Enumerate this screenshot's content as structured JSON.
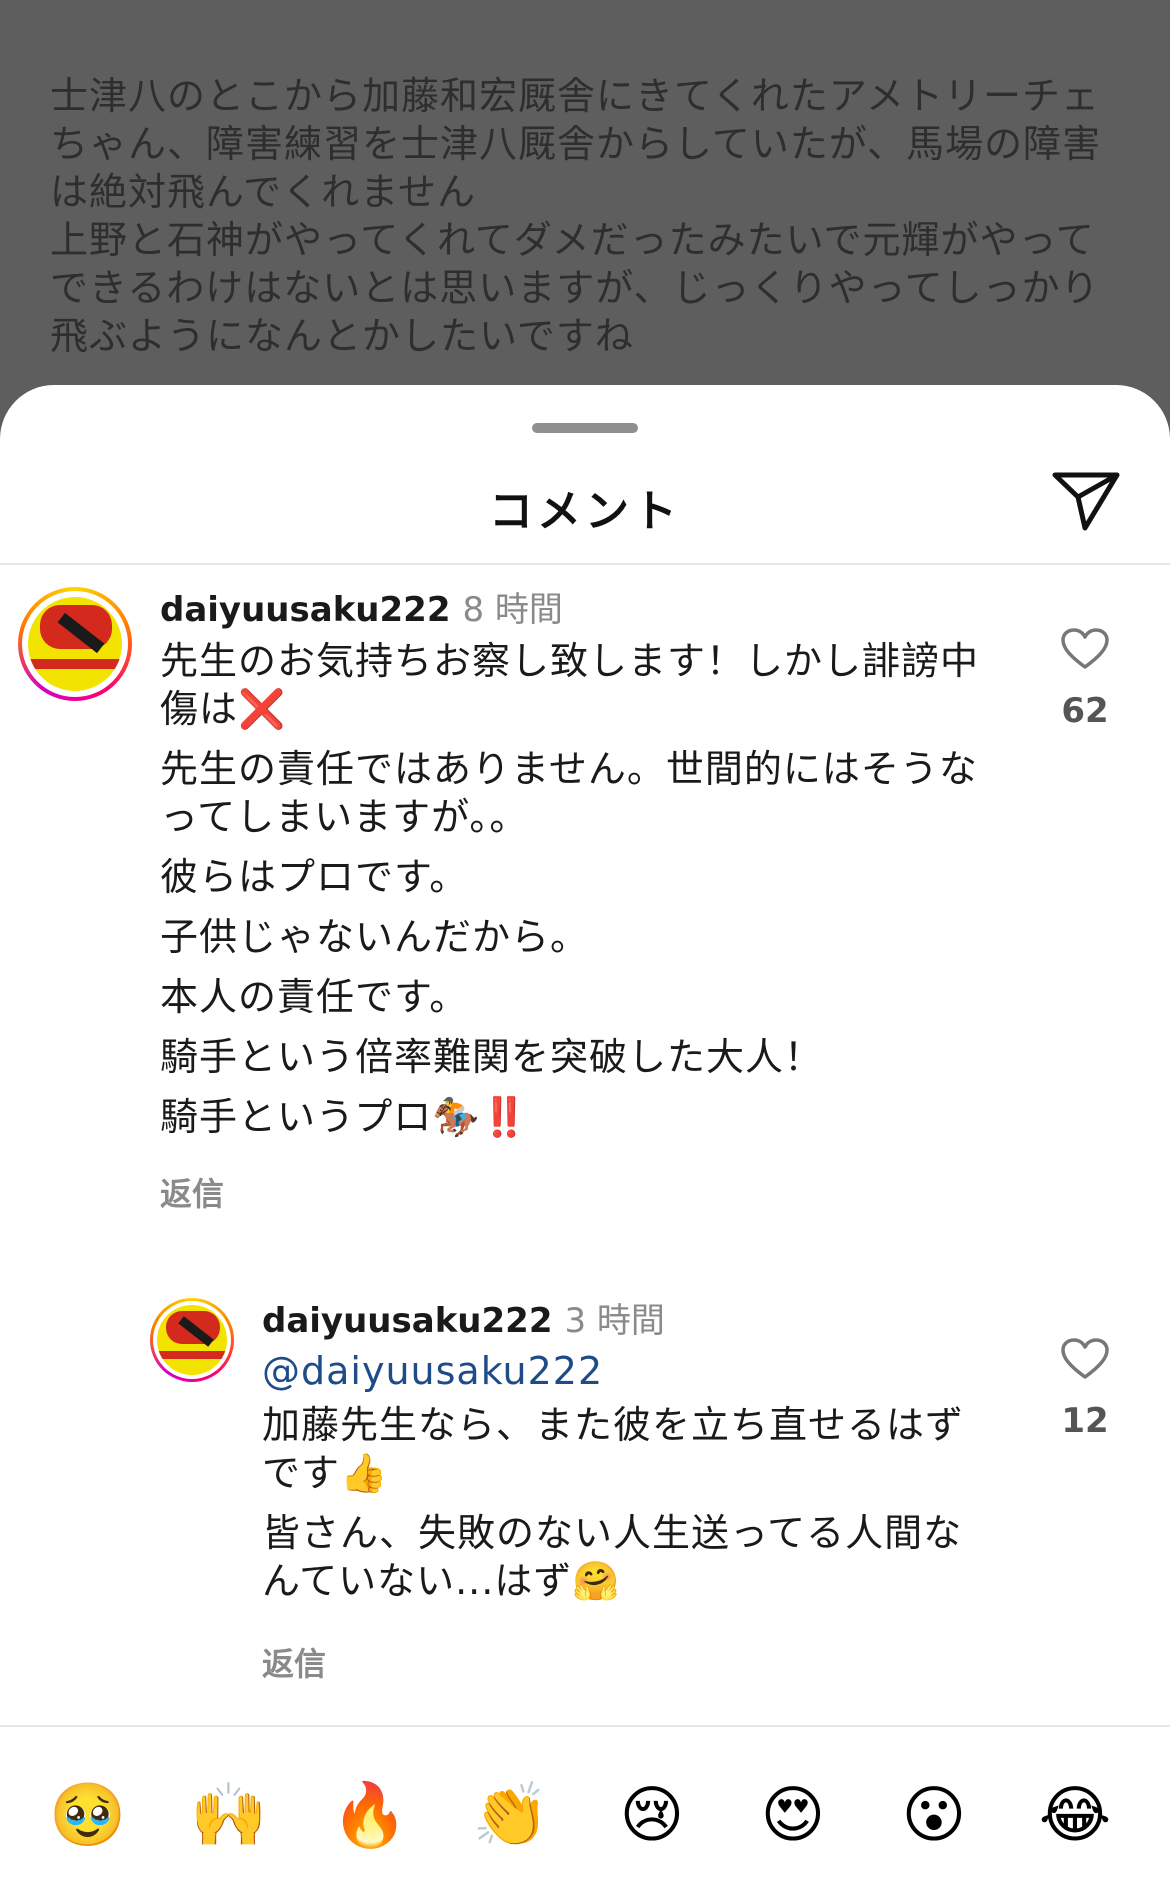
{
  "background_post": {
    "lines_p1": [
      "士津八のとこから加藤和宏厩舎にきてくれたアメトリーチェ",
      "ちゃん、障害練習を士津八厩舎からしていたが、馬場の障害",
      "は絶対飛んでくれません"
    ],
    "lines_p2": [
      "上野と石神がやってくれてダメだったみたいで元輝がやって",
      "できるわけはないとは思いますが、じっくりやってしっかり",
      "飛ぶようになんとかしたいですね"
    ]
  },
  "sheet": {
    "title": "コメント",
    "send_icon": "paper-plane-icon"
  },
  "comments": [
    {
      "username": "daiyuusaku222",
      "time": "8 時間",
      "paragraphs": [
        {
          "text": "先生のお気持ちお察し致します！しかし誹謗中傷は",
          "emoji": "❌"
        },
        {
          "text": "先生の責任ではありません。世間的にはそうなってしまいますが。。",
          "emoji": ""
        },
        {
          "text": "彼らはプロです。",
          "emoji": ""
        },
        {
          "text": "子供じゃないんだから。",
          "emoji": ""
        },
        {
          "text": "本人の責任です。",
          "emoji": ""
        },
        {
          "text": "騎手という倍率難関を突破した大人！",
          "emoji": ""
        },
        {
          "text": "騎手というプロ",
          "emoji": "🏇‼️"
        }
      ],
      "reply_label": "返信",
      "likes": "62"
    },
    {
      "username": "daiyuusaku222",
      "time": "3 時間",
      "mention": "@daiyuusaku222",
      "paragraphs": [
        {
          "text": "加藤先生なら、また彼を立ち直せるはずです",
          "emoji": "👍"
        },
        {
          "text": "皆さん、失敗のない人生送ってる人間なんていない...はず",
          "emoji": "🤗"
        }
      ],
      "reply_label": "返信",
      "likes": "12"
    }
  ],
  "emoji_bar": [
    "🥹",
    "🙌",
    "🔥",
    "👏",
    "😢",
    "😍",
    "😮",
    "😂"
  ],
  "colors": {
    "mention": "#1f4c86",
    "muted": "#8a8a8a",
    "backdrop": "#5e5e5e"
  }
}
